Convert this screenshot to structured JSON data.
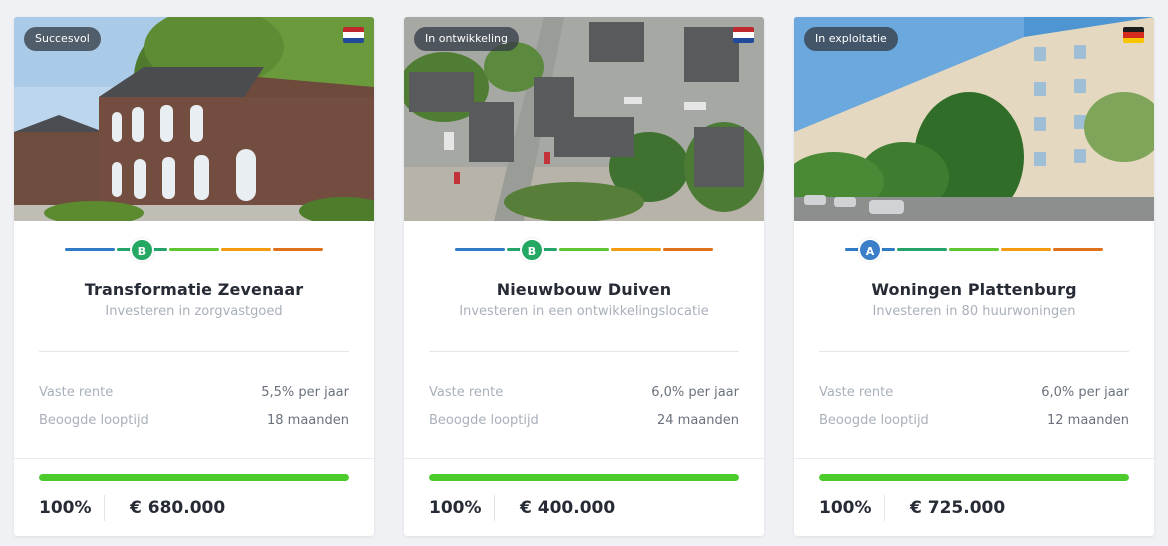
{
  "colors": {
    "rating_segments": [
      "#2f7ac4",
      "#24a36b",
      "#5ec631",
      "#f29a10",
      "#e0711c"
    ],
    "badge_a": "#3a7fc8",
    "badge_b": "#24a862",
    "progress": "#4ccb2c"
  },
  "projects": [
    {
      "status": "Succesvol",
      "country_flag": "netherlands-flag",
      "image": "photo-brick-building",
      "rating": "B",
      "title": "Transformatie Zevenaar",
      "subtitle": "Investeren in zorgvastgoed",
      "rate_label": "Vaste rente",
      "rate_value": "5,5% per jaar",
      "term_label": "Beoogde looptijd",
      "term_value": "18 maanden",
      "progress_percent": 100,
      "progress_text": "100%",
      "amount": "€ 680.000"
    },
    {
      "status": "In ontwikkeling",
      "country_flag": "netherlands-flag",
      "image": "photo-aerial-site",
      "rating": "B",
      "title": "Nieuwbouw Duiven",
      "subtitle": "Investeren in een ontwikkelingslocatie",
      "rate_label": "Vaste rente",
      "rate_value": "6,0% per jaar",
      "term_label": "Beoogde looptijd",
      "term_value": "24 maanden",
      "progress_percent": 100,
      "progress_text": "100%",
      "amount": "€ 400.000"
    },
    {
      "status": "In exploitatie",
      "country_flag": "germany-flag",
      "image": "photo-apartment-block",
      "rating": "A",
      "title": "Woningen Plattenburg",
      "subtitle": "Investeren in 80 huurwoningen",
      "rate_label": "Vaste rente",
      "rate_value": "6,0% per jaar",
      "term_label": "Beoogde looptijd",
      "term_value": "12 maanden",
      "progress_percent": 100,
      "progress_text": "100%",
      "amount": "€ 725.000"
    }
  ]
}
